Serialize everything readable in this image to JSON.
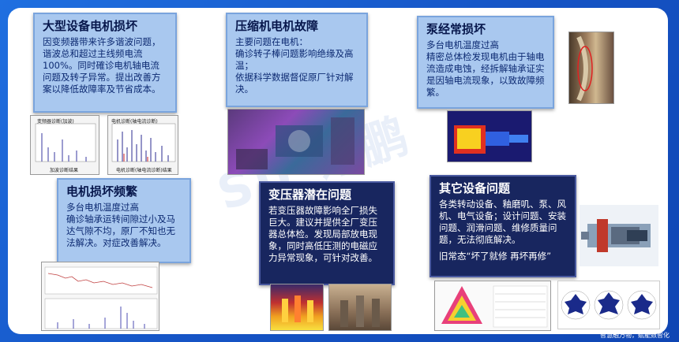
{
  "watermark": "SU 讯鹏",
  "footer": "智慧融万物，赋能数智化",
  "cards": {
    "motor_damage": {
      "title": "大型设备电机损坏",
      "body": "因变频器带来许多谐波问题，谐波总和超过主线频电流100%。同时確诊电机轴电流问题及转子异常。提出改善方案以降低故障率及节省成本。"
    },
    "compressor": {
      "title": "压缩机电机故障",
      "body": "主要问题在电机：\n确诊转子棒问题影响绝缘及高温；\n依据科学数据督促原厂针对解决。"
    },
    "pump": {
      "title": "泵经常损坏",
      "body": "多台电机温度过高\n精密总体检发现电机由于轴电流造成电蚀，经拆解轴承证实是因轴电流现象，以致故障频繁。"
    },
    "motor_frequent": {
      "title": "电机损坏频繁",
      "body": "多台电机温度过高\n确诊轴承运转间隙过小及马达气隙不均，原厂不知也无法解决。对症改善解决。"
    },
    "transformer": {
      "title": "变压器潜在问题",
      "body": "若变压器故障影响全厂损失巨大。建议并提供全厂变压器总体检。发现局部放电现象，同时高低压测的电磁应力异常现象，可针对改善。"
    },
    "other": {
      "title": "其它设备问题",
      "body": "各类转动设备、釉磨叽、泵、风机、电气设备；设计问题、安装问题、润滑问题、维修质量问题，无法彻底解决。",
      "tail": "旧常态“坏了就修 再坏再修”"
    }
  },
  "images": {
    "spectrum_left_title": "变频器诊断(加波)",
    "spectrum_left_caption": "加波诊断结果",
    "spectrum_right_title": "电机诊断(轴电流诊断)",
    "spectrum_right_caption": "电机诊断(轴电流诊断)结果"
  }
}
